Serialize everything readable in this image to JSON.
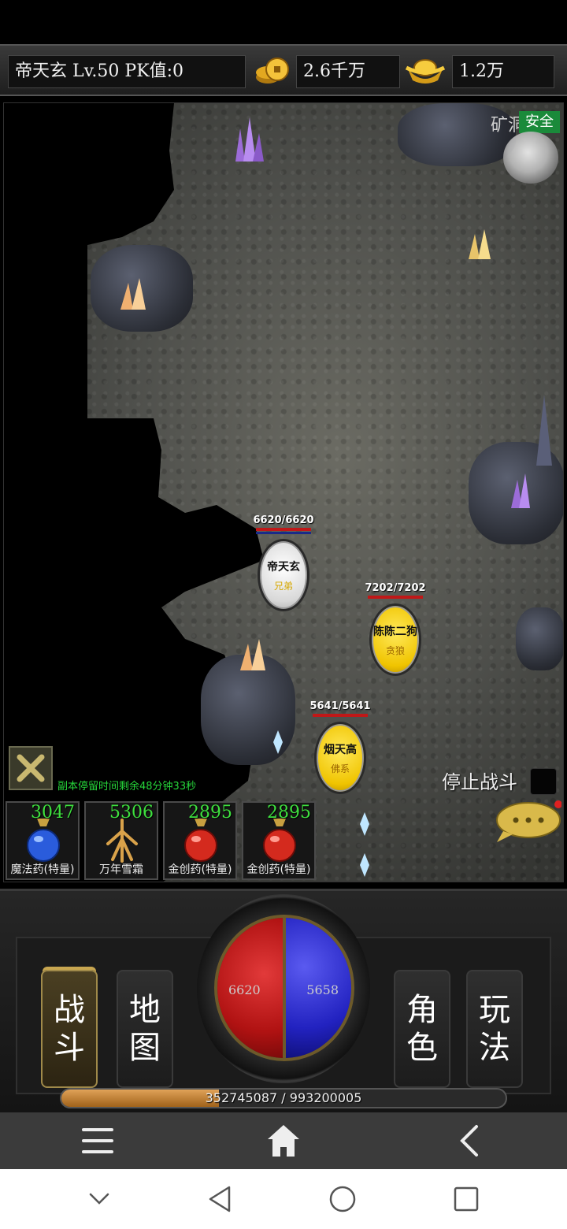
{
  "player": {
    "name_level_pk": "帝天玄  Lv.50 PK值:0",
    "gold": "2.6千万",
    "ingot": "1.2万"
  },
  "map": {
    "area_name": "矿洞",
    "safety": "安全",
    "dungeon_timer": "副本停留时间剩余48分钟33秒",
    "stop_fight_label": "停止战斗"
  },
  "units": [
    {
      "hp": "6620/6620",
      "name": "帝天玄",
      "role": "兄弟",
      "style": "white"
    },
    {
      "hp": "7202/7202",
      "name": "陈陈二狗",
      "role": "贪狼",
      "style": "yellow"
    },
    {
      "hp": "5641/5641",
      "name": "烟天高",
      "role": "佛系",
      "style": "yellow"
    }
  ],
  "potions": [
    {
      "count": "3047",
      "label": "魔法药(特量)",
      "icon": "blue-potion-icon"
    },
    {
      "count": "5306",
      "label": "万年雪霜",
      "icon": "snow-ginseng-icon"
    },
    {
      "count": "2895",
      "label": "金创药(特量)",
      "icon": "red-potion-icon"
    },
    {
      "count": "2895",
      "label": "金创药(特量)",
      "icon": "red-potion-icon"
    }
  ],
  "orb": {
    "hp": "6620",
    "mp": "5658"
  },
  "menu": {
    "battle": [
      "战",
      "斗"
    ],
    "map": [
      "地",
      "图"
    ],
    "character": [
      "角",
      "色"
    ],
    "gameplay": [
      "玩",
      "法"
    ]
  },
  "exp": {
    "text": "352745087 / 993200005",
    "fraction": 0.355
  },
  "colors": {
    "hp": "#c01818",
    "mp": "#2222c0",
    "timer": "#26d63a",
    "potion_count": "#3ee03e"
  }
}
